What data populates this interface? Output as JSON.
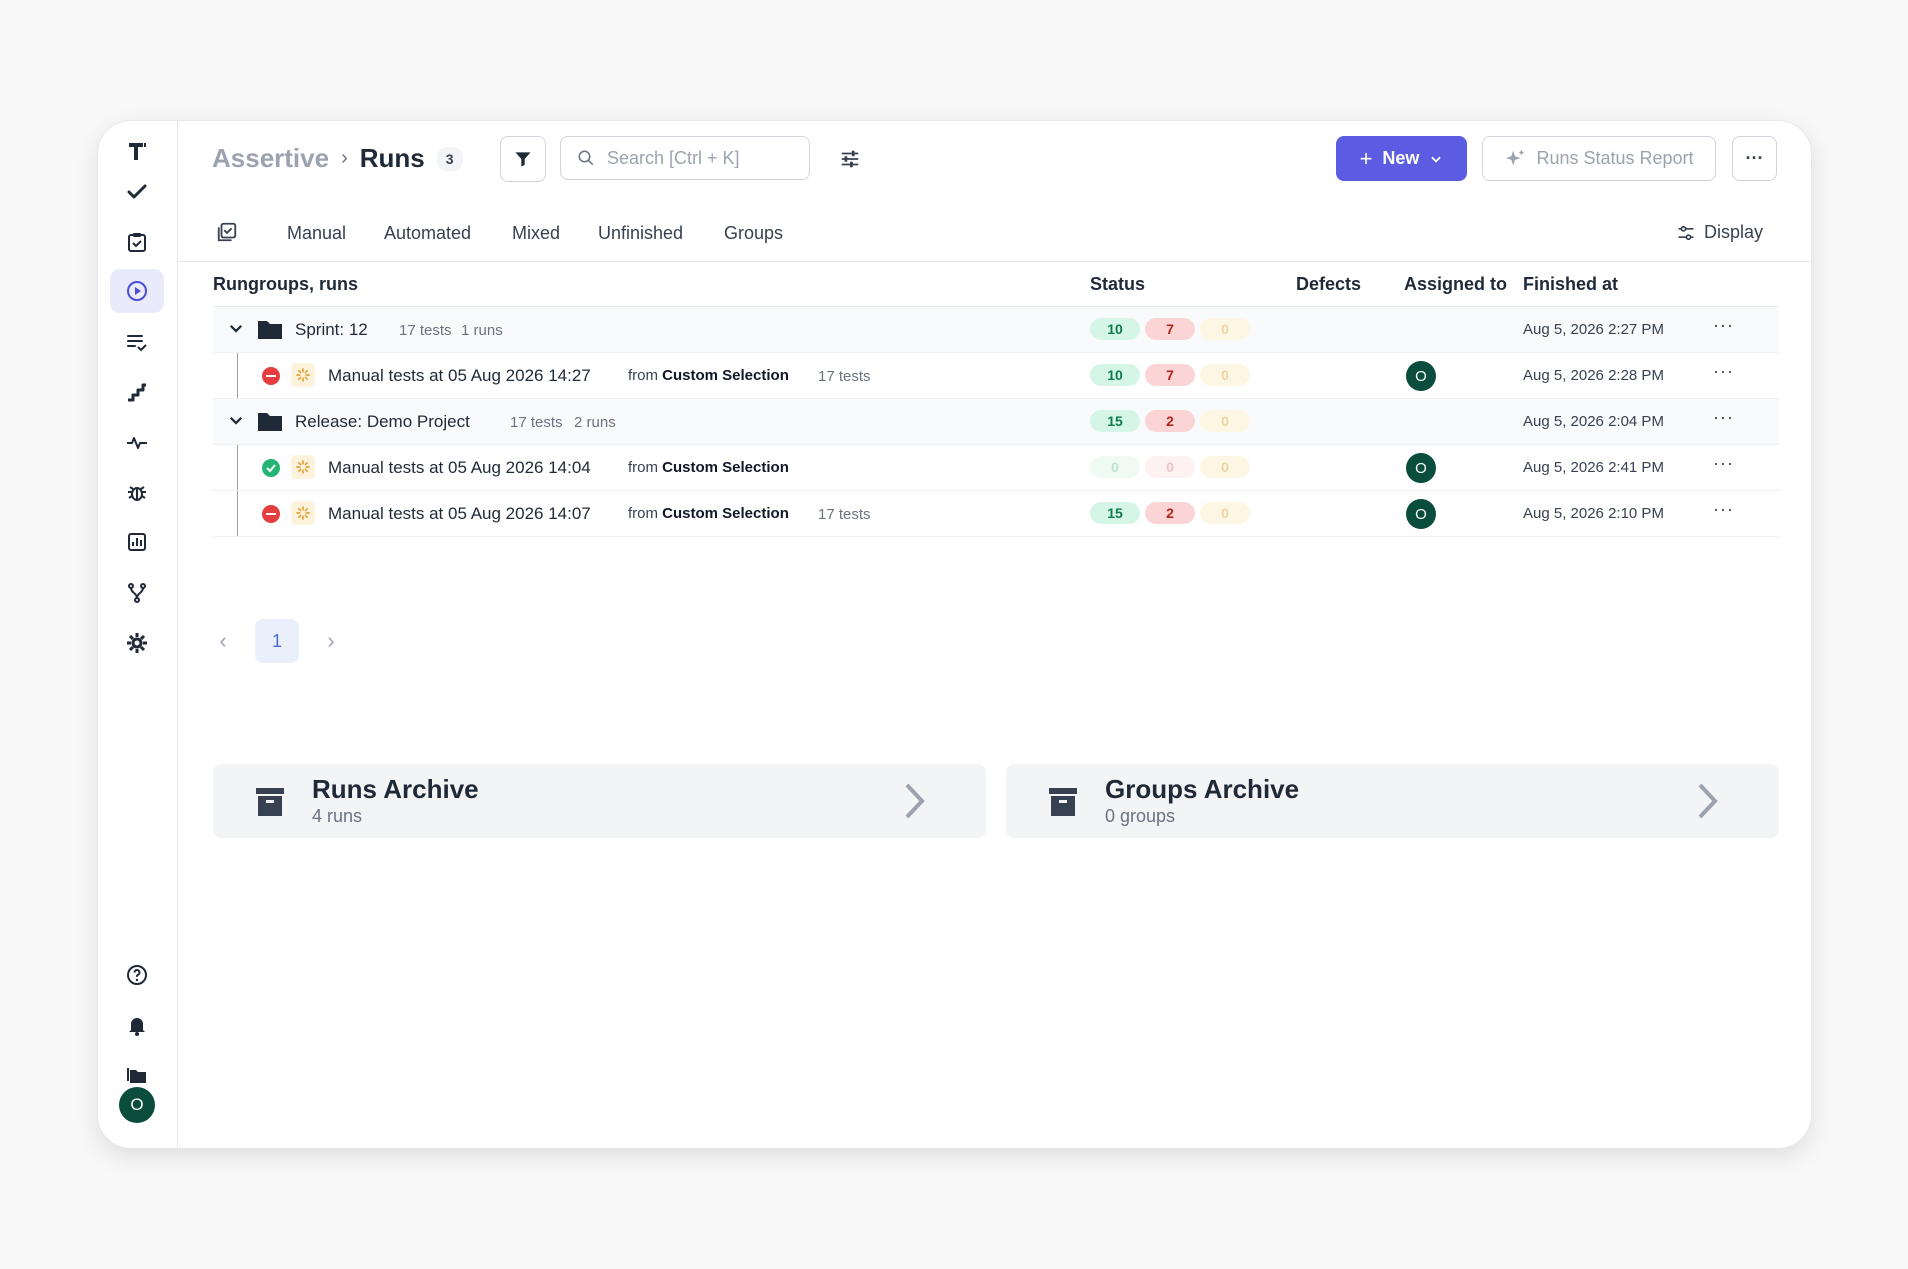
{
  "breadcrumb": {
    "project": "Assertive",
    "separator": "›",
    "page": "Runs",
    "count": "3"
  },
  "search": {
    "placeholder": "Search [Ctrl + K]"
  },
  "toolbar": {
    "new_label": "New",
    "report_label": "Runs Status Report",
    "more_label": "···"
  },
  "tabs": [
    "Manual",
    "Automated",
    "Mixed",
    "Unfinished",
    "Groups"
  ],
  "display_label": "Display",
  "columns": {
    "name": "Rungroups, runs",
    "status": "Status",
    "defects": "Defects",
    "assigned": "Assigned to",
    "finished": "Finished at"
  },
  "rows": [
    {
      "kind": "group",
      "name": "Sprint: 12",
      "tests": "17 tests",
      "runs": "1 runs",
      "passed": "10",
      "failed": "7",
      "skipped": "0",
      "finished": "Aug 5, 2026 2:27 PM",
      "more": "···"
    },
    {
      "kind": "run",
      "status": "failed",
      "title": "Manual tests at 05 Aug 2026 14:27",
      "from": "from",
      "source": "Custom Selection",
      "tests": "17 tests",
      "passed": "10",
      "failed": "7",
      "skipped": "0",
      "assignee": "O",
      "finished": "Aug 5, 2026 2:28 PM",
      "more": "···"
    },
    {
      "kind": "group",
      "name": "Release: Demo Project",
      "tests": "17 tests",
      "runs": "2 runs",
      "passed": "15",
      "failed": "2",
      "skipped": "0",
      "finished": "Aug 5, 2026 2:04 PM",
      "more": "···"
    },
    {
      "kind": "run",
      "status": "passed",
      "title": "Manual tests at 05 Aug 2026 14:04",
      "from": "from",
      "source": "Custom Selection",
      "tests": "",
      "passed": "0",
      "failed": "0",
      "skipped": "0",
      "assignee": "O",
      "finished": "Aug 5, 2026 2:41 PM",
      "more": "···"
    },
    {
      "kind": "run",
      "status": "failed",
      "title": "Manual tests at 05 Aug 2026 14:07",
      "from": "from",
      "source": "Custom Selection",
      "tests": "17 tests",
      "passed": "15",
      "failed": "2",
      "skipped": "0",
      "assignee": "O",
      "finished": "Aug 5, 2026 2:10 PM",
      "more": "···"
    }
  ],
  "pagination": {
    "prev": "‹",
    "page": "1",
    "next": "›"
  },
  "archives": [
    {
      "title": "Runs Archive",
      "subtitle": "4 runs"
    },
    {
      "title": "Groups Archive",
      "subtitle": "0 groups"
    }
  ],
  "user": {
    "initial": "O"
  },
  "sidebar": {
    "icons": [
      "logo-icon",
      "check-icon",
      "clipboard-check-icon",
      "play-circle-icon",
      "list-check-icon",
      "stairs-icon",
      "pulse-icon",
      "bug-icon",
      "chart-icon",
      "branch-icon",
      "gear-icon",
      "help-icon",
      "bell-icon",
      "folders-icon"
    ]
  },
  "colors": {
    "accent": "#5b5ce2",
    "avatar": "#0a4d3c",
    "passed": "#22b573",
    "failed": "#e53e3e"
  }
}
